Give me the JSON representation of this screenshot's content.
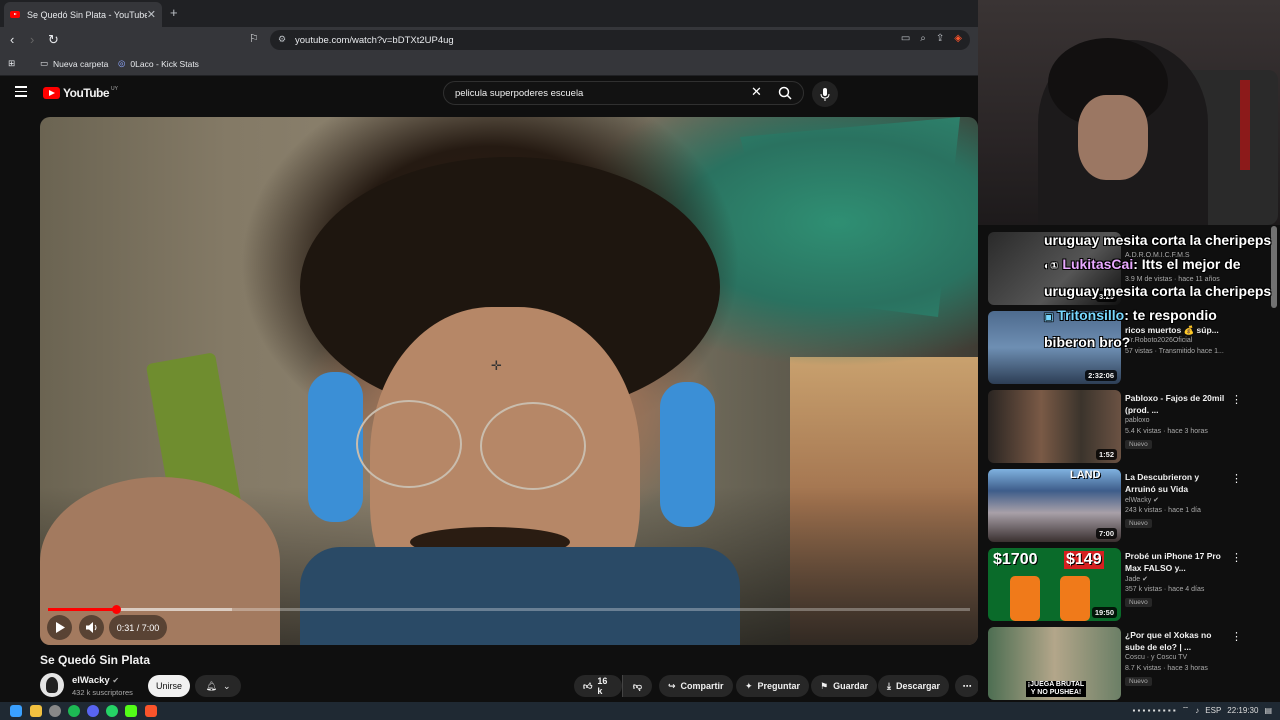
{
  "browser": {
    "tab_title": "Se Quedó Sin Plata - YouTube",
    "tab_close": "✕",
    "new_tab": "+",
    "url": "youtube.com/watch?v=bDTXt2UP4ug",
    "bookmarks": [
      {
        "label": "Nueva carpeta",
        "icon": "folder-icon"
      },
      {
        "label": "0Laco - Kick Stats",
        "icon": "kick-icon"
      }
    ]
  },
  "youtube": {
    "logo_text": "YouTube",
    "country_code": "UY",
    "search_value": "pelicula superpoderes escuela"
  },
  "player": {
    "current_time": "0:31",
    "duration": "7:00",
    "time_display": "0:31 / 7:00",
    "played_fraction": 0.074,
    "buffered_fraction": 0.2
  },
  "video": {
    "title": "Se Quedó Sin Plata",
    "channel": "elWacky",
    "subscribers": "432 k suscriptores",
    "join_label": "Unirse",
    "likes": "16 k",
    "share_label": "Compartir",
    "ask_label": "Preguntar",
    "save_label": "Guardar",
    "download_label": "Descargar"
  },
  "recommendations": [
    {
      "title": "",
      "channel": "A.D.R.O.M.I.C.F.M.S",
      "meta": "3.9 M de vistas · hace 11 años",
      "duration": "3:29",
      "badge": ""
    },
    {
      "title": "ricos muertos 💰 súp...",
      "channel": "Mr.Roboto2026Oficial",
      "meta": "57 vistas · Transmitido hace 1...",
      "duration": "2:32:06",
      "badge": ""
    },
    {
      "title": "Pabloxo - Fajos de 20mil (prod. ...",
      "channel": "pabloxo",
      "meta": "5.4 K vistas · hace 3 horas",
      "duration": "1:52",
      "badge": "Nuevo"
    },
    {
      "title": "La Descubrieron y Arruinó su Vida",
      "channel": "elWacky",
      "meta": "243 k vistas · hace 1 día",
      "duration": "7:00",
      "badge": "Nuevo"
    },
    {
      "title": "Probé un iPhone 17 Pro Max FALSO y...",
      "channel": "Jade",
      "meta": "357 k vistas · hace 4 días",
      "duration": "19:50",
      "badge": "Nuevo"
    },
    {
      "title": "¿Por que el Xokas no sube de elo? | ...",
      "channel": "Coscu · y Coscu TV",
      "meta": "8.7 K vistas · hace 3 horas",
      "duration": "",
      "badge": "Nuevo"
    }
  ],
  "chat": [
    {
      "user": "",
      "text": "uruguay mesita corta la cheripeps"
    },
    {
      "user": "LukitasCai",
      "text": ": Itts el mejor de"
    },
    {
      "user": "",
      "text": "uruguay mesita corta la cheripeps"
    },
    {
      "user": "Tritonsillo",
      "text": ": te respondio"
    },
    {
      "user": "",
      "text": "biberon bro?"
    }
  ],
  "thumb_texts": {
    "iphone_left": "$1700",
    "iphone_right": "$149",
    "xokas_caption": "¡JUEGA BRUTAL Y NO PUSHEA!",
    "land": "LAND"
  },
  "taskbar": {
    "language": "ESP",
    "time": "22:19:30"
  },
  "colors": {
    "youtube_red": "#ff0000",
    "background": "#0f0f0f",
    "chip": "#272727"
  }
}
